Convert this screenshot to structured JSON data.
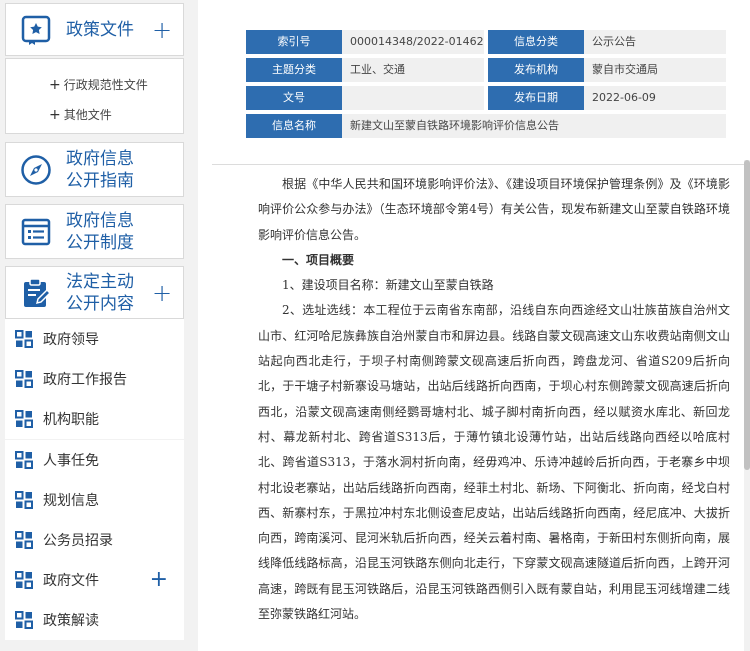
{
  "sidebar": {
    "policy_files": {
      "title": "政策文件"
    },
    "policy_sub": [
      {
        "label": "行政规范性文件"
      },
      {
        "label": "其他文件"
      }
    ],
    "disclosure_guide": {
      "title_l1": "政府信息",
      "title_l2": "公开指南"
    },
    "disclosure_system": {
      "title_l1": "政府信息",
      "title_l2": "公开制度"
    },
    "statutory": {
      "title_l1": "法定主动",
      "title_l2": "公开内容"
    },
    "nav": [
      {
        "label": "政府领导"
      },
      {
        "label": "政府工作报告"
      },
      {
        "label": "机构职能"
      },
      {
        "label": "人事任免"
      },
      {
        "label": "规划信息"
      },
      {
        "label": "公务员招录"
      },
      {
        "label": "政府文件"
      },
      {
        "label": "政策解读"
      }
    ],
    "plus_glyph": "+",
    "accent": "#1f5fa6"
  },
  "meta": {
    "index_label": "索引号",
    "index_value": "000014348/2022-01462",
    "category_label": "信息分类",
    "category_value": "公示公告",
    "topic_label": "主题分类",
    "topic_value": "工业、交通",
    "publisher_label": "发布机构",
    "publisher_value": "蒙自市交通局",
    "docno_label": "文号",
    "docno_value": "",
    "date_label": "发布日期",
    "date_value": "2022-06-09",
    "name_label": "信息名称",
    "name_value": "新建文山至蒙自铁路环境影响评价信息公告",
    "label_bg": "#2e6db0"
  },
  "article": {
    "p1": "根据《中华人民共和国环境影响评价法》、《建设项目环境保护管理条例》及《环境影响评价公众参与办法》（生态环境部令第4号）有关公告，现发布新建文山至蒙自铁路环境影响评价信息公告。",
    "h1": "一、项目概要",
    "p2": "1、建设项目名称：新建文山至蒙自铁路",
    "p3": "2、选址选线：本工程位于云南省东南部，沿线自东向西途经文山壮族苗族自治州文山市、红河哈尼族彝族自治州蒙自市和屏边县。线路自蒙文砚高速文山东收费站南侧文山站起向西北走行，于坝子村南侧跨蒙文砚高速后折向西，跨盘龙河、省道S209后折向北，于干塘子村新寨设马塘站，出站后线路折向西南，于坝心村东侧跨蒙文砚高速后折向西北，沿蒙文砚高速南侧经鹦哥塘村北、城子脚村南折向西，经以赋资水库北、新回龙村、幕龙新村北、跨省道S313后，于薄竹镇北设薄竹站，出站后线路向西经以哈底村北、跨省道S313，于落水洞村折向南，经毋鸡冲、乐诗冲越岭后折向西，于老寨乡中坝村北设老寨站，出站后线路折向西南，经菲土村北、新场、下阿衡北、折向南，经戈白村西、新寨村东，于黑拉冲村东北侧设查尼皮站，出站后线路折向西南，经尼底冲、大拔折向西，跨南溪河、昆河米轨后折向西，经关云着村南、暑格南，于新田村东侧折向南，展线降低线路标高，沿昆玉河铁路东侧向北走行，下穿蒙文砚高速隧道后折向西，上跨开河高速，跨既有昆玉河铁路后，沿昆玉河铁路西侧引入既有蒙自站，利用昆玉河线增建二线至弥蒙铁路红河站。"
  }
}
